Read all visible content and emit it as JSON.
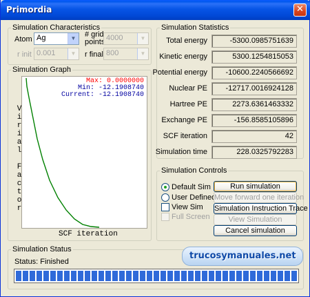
{
  "window": {
    "title": "Primordia",
    "close_glyph": "✕"
  },
  "sim_characteristics": {
    "legend": "Simulation Characteristics",
    "atom_label": "Atom",
    "atom_value": "Ag",
    "grid_points_label_line1": "# grid",
    "grid_points_label_line2": "points",
    "grid_points_value": "4000",
    "r_init_label": "r init",
    "r_init_value": "0.001",
    "r_final_label": "r final",
    "r_final_value": "800"
  },
  "sim_graph": {
    "legend": "Simulation Graph",
    "max_text": "Max: 0.0000000",
    "min_text": "Min: -12.1908740",
    "current_text": "Current: -12.1908740",
    "y_label_chars": [
      "V",
      "i",
      "r",
      "i",
      "a",
      "l",
      "",
      "F",
      "a",
      "c",
      "t",
      "o",
      "r"
    ],
    "x_label": "SCF iteration",
    "colors": {
      "max": "#ff0000",
      "min": "#0000a0",
      "current": "#0000a0",
      "curve": "#008000"
    }
  },
  "sim_statistics": {
    "legend": "Simulation Statistics",
    "rows": [
      {
        "label": "Total energy",
        "value": "-5300.0985751639"
      },
      {
        "label": "Kinetic energy",
        "value": "5300.1254815053"
      },
      {
        "label": "Potential energy",
        "value": "-10600.2240566692"
      },
      {
        "label": "Nuclear PE",
        "value": "-12717.0016924128"
      },
      {
        "label": "Hartree PE",
        "value": "2273.6361463332"
      },
      {
        "label": "Exchange PE",
        "value": "-156.8585105896"
      },
      {
        "label": "SCF iteration",
        "value": "42"
      },
      {
        "label": "Simulation time",
        "value": "228.0325792283"
      }
    ]
  },
  "sim_controls": {
    "legend": "Simulation Controls",
    "default_sim_label": "Default Sim",
    "user_defined_label": "User Defined",
    "view_sim_label": "View Sim",
    "full_screen_label": "Full Screen",
    "run_label": "Run simulation",
    "move_forward_label": "Move forward one iteration",
    "instruction_trace_label": "Simulation Instruction Trace",
    "view_simulation_label": "View Simulation",
    "cancel_label": "Cancel simulation"
  },
  "sim_status": {
    "legend": "Simulation Status",
    "status_text": "Status: Finished",
    "progress_fraction": 1.0
  },
  "watermark": {
    "text": "trucosymanuales.net"
  }
}
